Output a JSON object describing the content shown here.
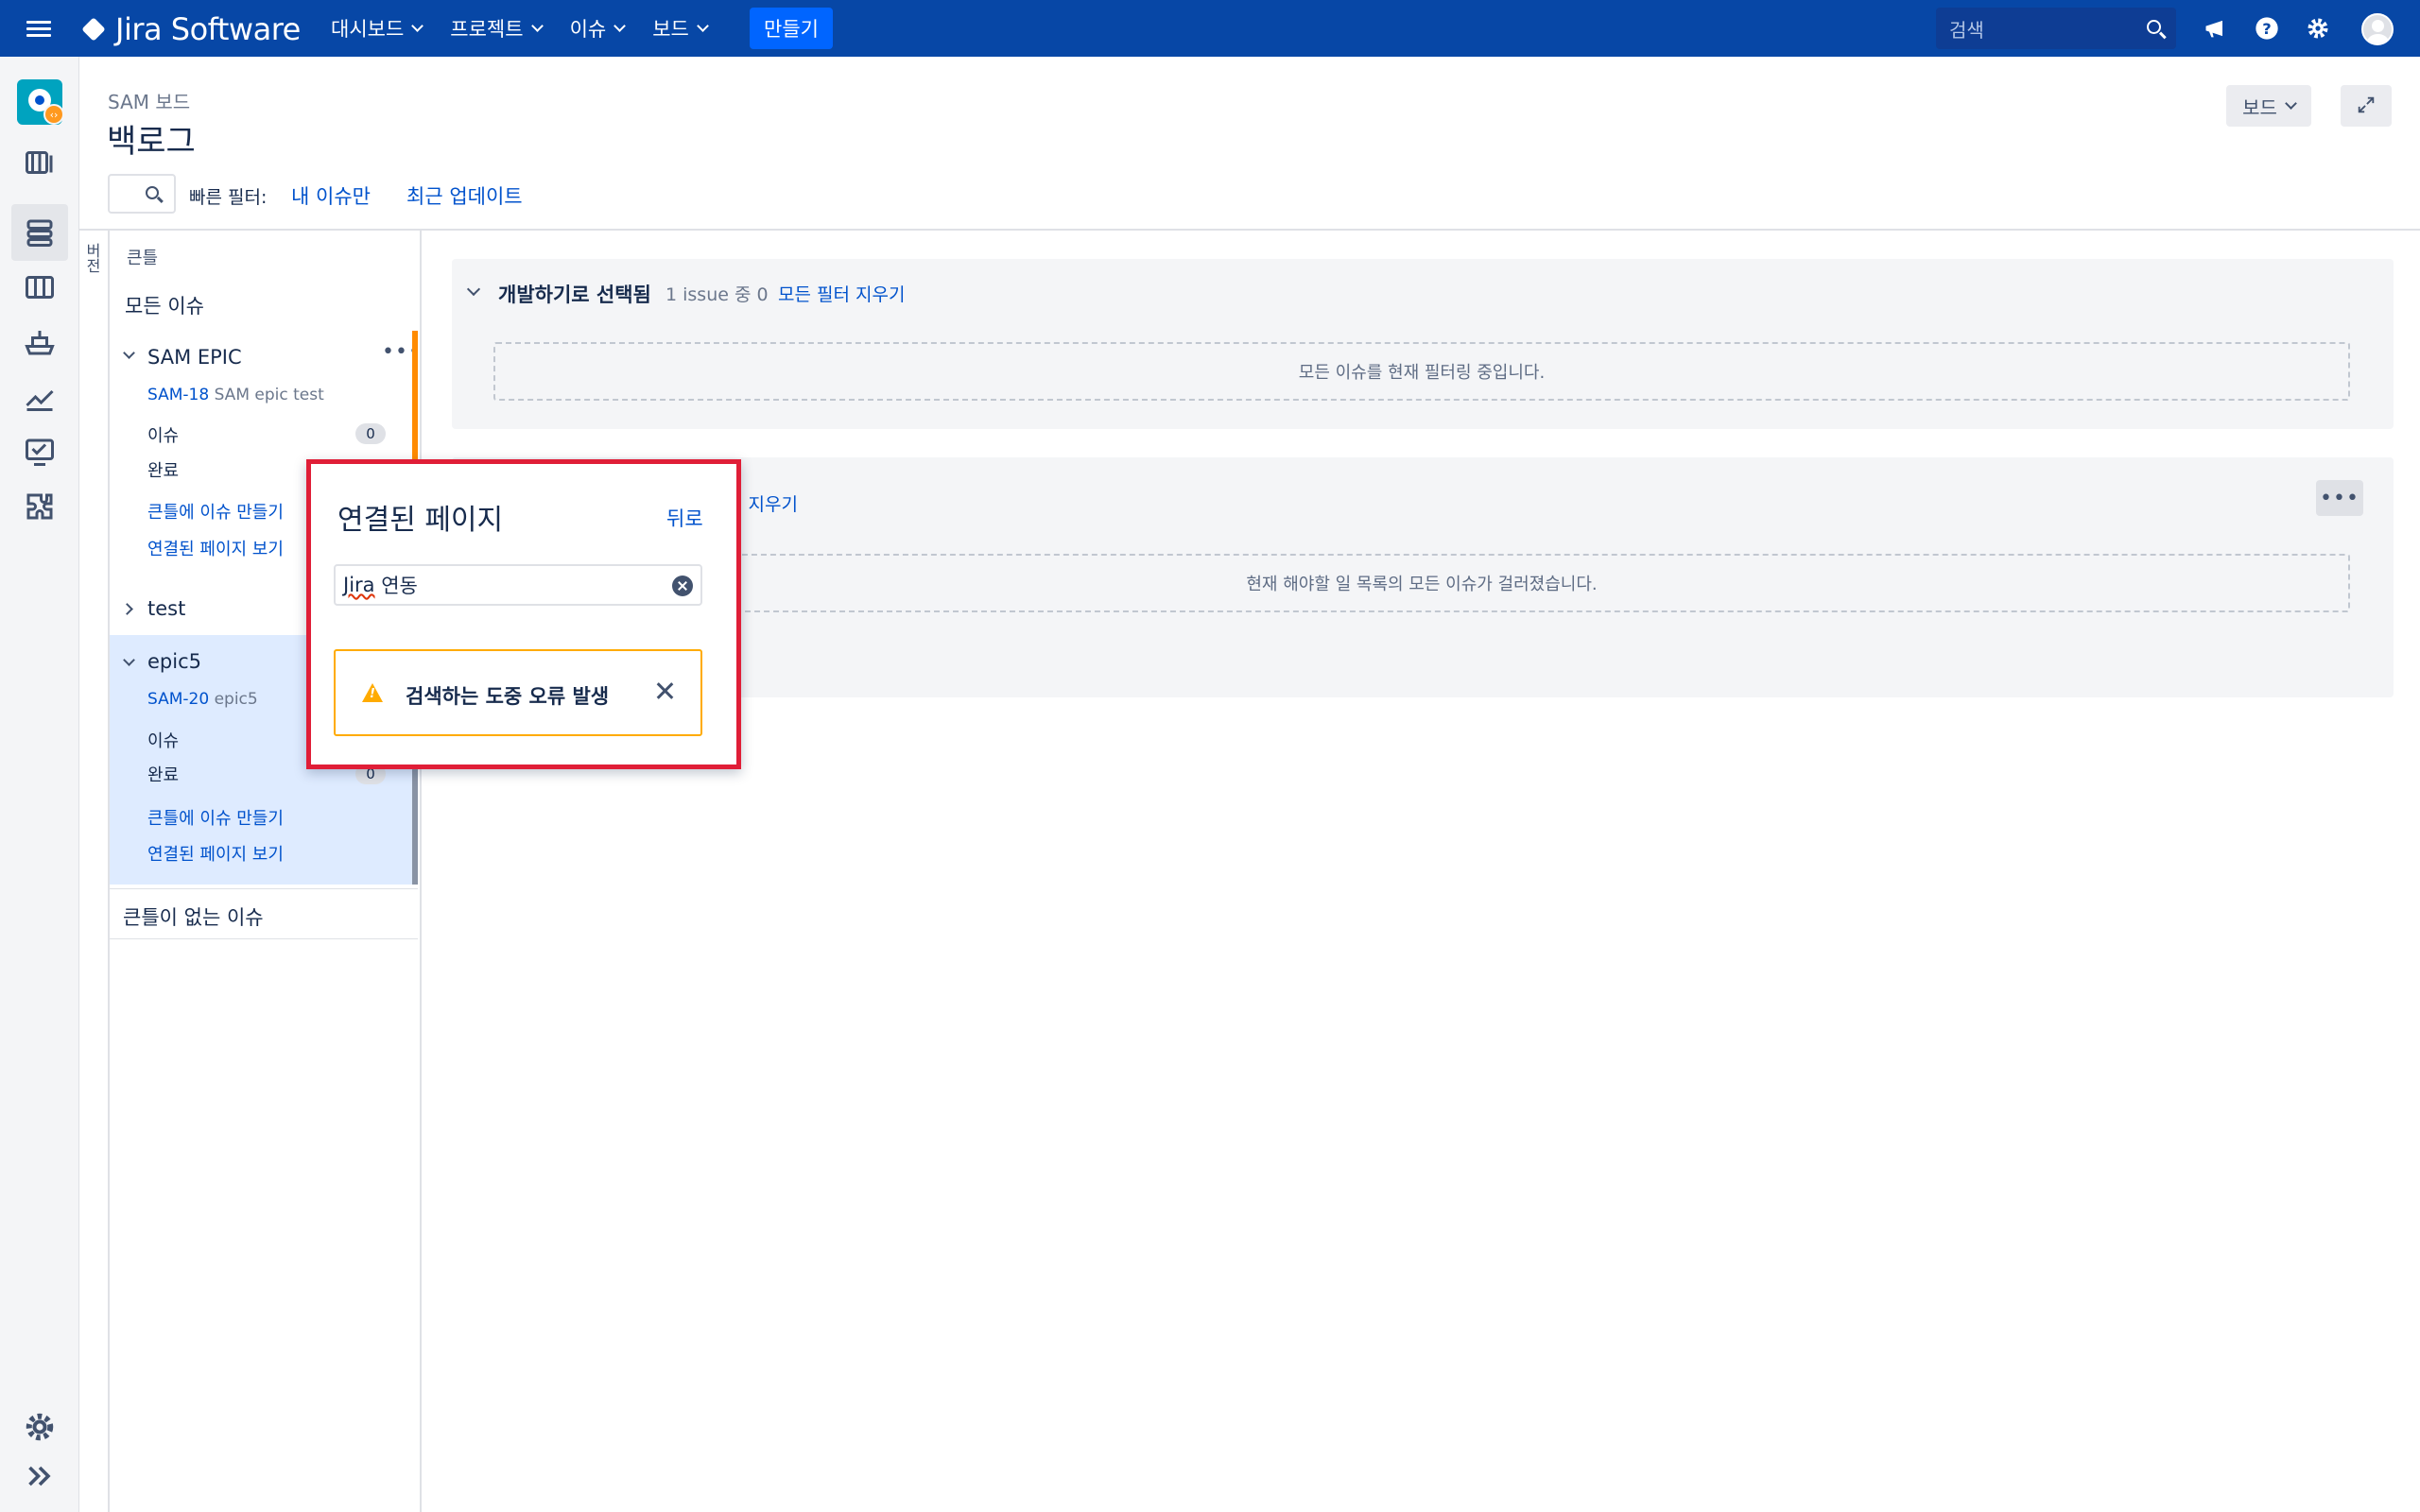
{
  "topbar": {
    "product": "Jira Software",
    "nav": [
      {
        "label": "대시보드"
      },
      {
        "label": "프로젝트"
      },
      {
        "label": "이슈"
      },
      {
        "label": "보드"
      }
    ],
    "create_label": "만들기",
    "search_placeholder": "검색"
  },
  "page": {
    "board_name": "SAM 보드",
    "title": "백로그",
    "board_button": "보드",
    "quick_filter_label": "빠른 필터:",
    "quick_filters": [
      "내 이슈만",
      "최근 업데이트"
    ]
  },
  "side_tab": "버전",
  "epics": {
    "header": "큰틀",
    "all_issues": "모든 이슈",
    "items": [
      {
        "name": "SAM EPIC",
        "key": "SAM-18",
        "summary": "SAM epic test",
        "issues_label": "이슈",
        "issues_count": "0",
        "done_label": "완료",
        "create_link": "큰틀에 이슈 만들기",
        "pages_link": "연결된 페이지 보기"
      },
      {
        "name": "test"
      },
      {
        "name": "epic5",
        "key": "SAM-20",
        "summary": "epic5",
        "issues_label": "이슈",
        "done_label": "완료",
        "done_count": "0",
        "create_link": "큰틀에 이슈 만들기",
        "pages_link": "연결된 페이지 보기"
      }
    ],
    "no_epic": "큰틀이 없는 이슈"
  },
  "sprint": {
    "title": "개발하기로 선택됨",
    "count_text": "1 issue 중 0",
    "clear_filters": "모든 필터 지우기",
    "empty_text": "모든 이슈를 현재 필터링 중입니다."
  },
  "backlog": {
    "clear_filters": "터 지우기",
    "empty_text": "현재 해야할 일 목록의 모든 이슈가 걸러졌습니다."
  },
  "popup": {
    "title": "연결된 페이지",
    "back": "뒤로",
    "search_value_a": "Jira",
    "search_value_b": " 연동",
    "error_text": "검색하는 도중 오류 발생"
  },
  "colors": {
    "topbar": "#0747a6",
    "link": "#0052cc",
    "highlight_border": "#e01e37",
    "warning": "#ffab00"
  }
}
